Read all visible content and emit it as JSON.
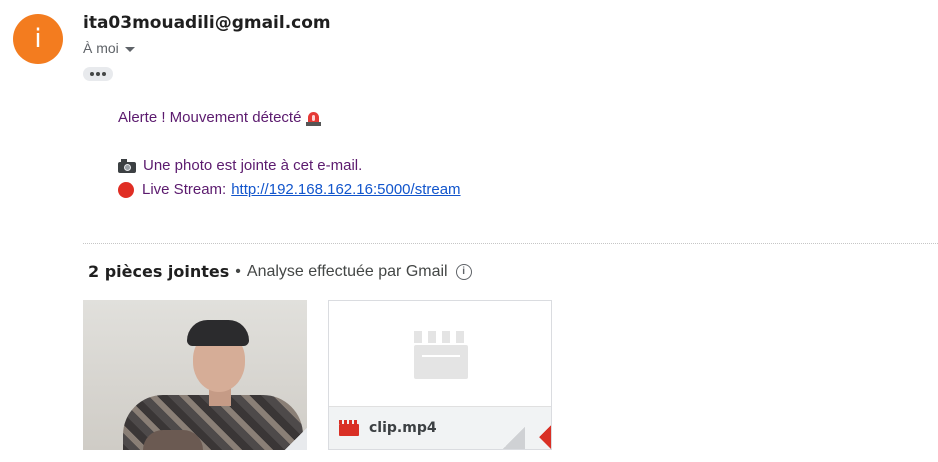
{
  "header": {
    "avatar_letter": "i",
    "avatar_color": "#f37c1f",
    "sender_email": "ita03mouadili@gmail.com",
    "recipient_label": "À moi"
  },
  "message": {
    "line1": "Alerte ! Mouvement détecté",
    "line2": "Une photo est jointe à cet e-mail.",
    "line3_label": "Live Stream:",
    "stream_link": "http://192.168.162.16:5000/stream",
    "text_color": "#5b1a6e",
    "link_color": "#1155cc"
  },
  "attachments": {
    "count_label": "2 pièces jointes",
    "separator": "•",
    "scan_label": "Analyse effectuée par Gmail",
    "items": [
      {
        "type": "image"
      },
      {
        "type": "video",
        "name": "clip.mp4"
      }
    ]
  },
  "icons": [
    "avatar",
    "chevron-down-icon",
    "more-icon",
    "siren-icon",
    "camera-icon",
    "red-circle-icon",
    "info-icon",
    "video-file-icon",
    "clapperboard-icon"
  ]
}
